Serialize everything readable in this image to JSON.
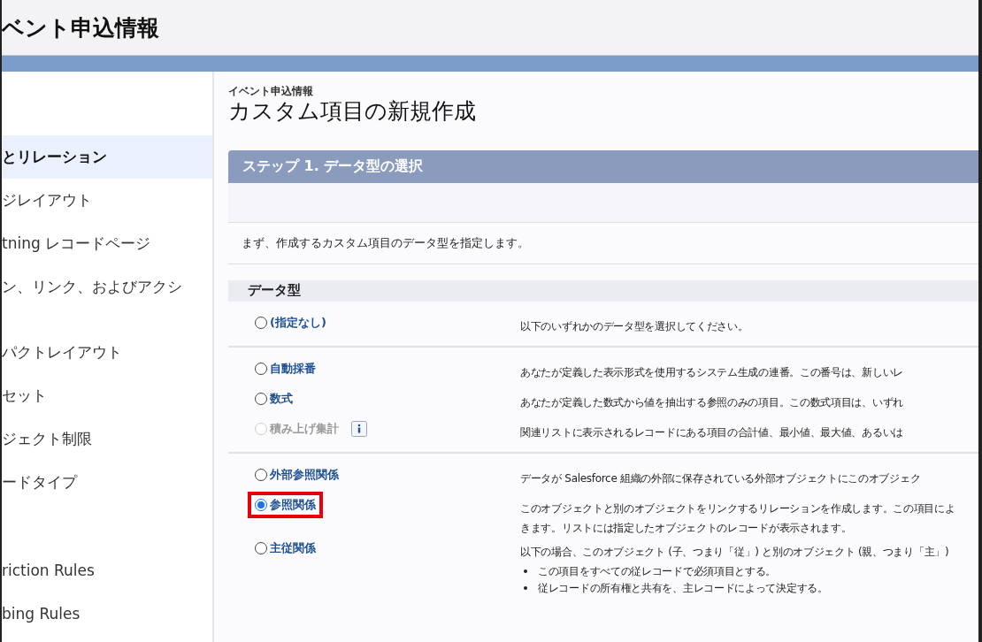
{
  "header": {
    "title": "ベント申込情報"
  },
  "sidebar": {
    "sections": [
      {
        "items": [
          {
            "label": "とリレーション",
            "selected": true
          },
          {
            "label": "ジレイアウト",
            "selected": false
          },
          {
            "label": "tning レコードページ",
            "selected": false
          },
          {
            "label": "ン、リンク、およびアクシ",
            "selected": false
          }
        ]
      },
      {
        "items": [
          {
            "label": "パクトレイアウト",
            "selected": false
          },
          {
            "label": "セット",
            "selected": false
          },
          {
            "label": "ジェクト制限",
            "selected": false
          },
          {
            "label": "ードタイプ",
            "selected": false
          }
        ]
      },
      {
        "items": [
          {
            "label": "riction Rules",
            "selected": false
          },
          {
            "label": "bing Rules",
            "selected": false
          }
        ]
      }
    ]
  },
  "page": {
    "breadcrumb": "イベント申込情報",
    "title": "カスタム項目の新規作成"
  },
  "step": {
    "title": "ステップ 1. データ型の選択",
    "instruction": "まず、作成するカスタム項目のデータ型を指定します。"
  },
  "data_type": {
    "heading": "データ型",
    "groups": [
      {
        "options": [
          {
            "label": "(指定なし)",
            "selected": false,
            "disabled": false,
            "highlighted": false,
            "description": [
              "以下のいずれかのデータ型を選択してください。"
            ]
          }
        ]
      },
      {
        "options": [
          {
            "label": "自動採番",
            "selected": false,
            "disabled": false,
            "highlighted": false,
            "description": [
              "あなたが定義した表示形式を使用するシステム生成の連番。この番号は、新しいレ"
            ]
          },
          {
            "label": "数式",
            "selected": false,
            "disabled": false,
            "highlighted": false,
            "description": [
              "あなたが定義した数式から値を抽出する参照のみの項目。この数式項目は、いずれ"
            ]
          },
          {
            "label": "積み上げ集計",
            "selected": false,
            "disabled": true,
            "highlighted": false,
            "info": true,
            "description": [
              "関連リストに表示されるレコードにある項目の合計値、最小値、最大値、あるいは"
            ]
          }
        ]
      },
      {
        "options": [
          {
            "label": "外部参照関係",
            "selected": false,
            "disabled": false,
            "highlighted": false,
            "description": [
              "データが Salesforce 組織の外部に保存されている外部オブジェクトにこのオブジェク"
            ]
          },
          {
            "label": "参照関係",
            "selected": true,
            "disabled": false,
            "highlighted": true,
            "description": [
              "このオブジェクトと別のオブジェクトをリンクするリレーションを作成します。この項目によ",
              "きます。リストには指定したオブジェクトのレコードが表示されます。"
            ]
          },
          {
            "label": "主従関係",
            "selected": false,
            "disabled": false,
            "highlighted": false,
            "description": [
              "以下の場合、このオブジェクト (子、つまり「従」) と別のオブジェクト (親、つまり「主」)"
            ],
            "bullets": [
              "この項目をすべての従レコードで必須項目とする。",
              "従レコードの所有権と共有を、主レコードによって決定する。"
            ]
          }
        ]
      }
    ]
  }
}
